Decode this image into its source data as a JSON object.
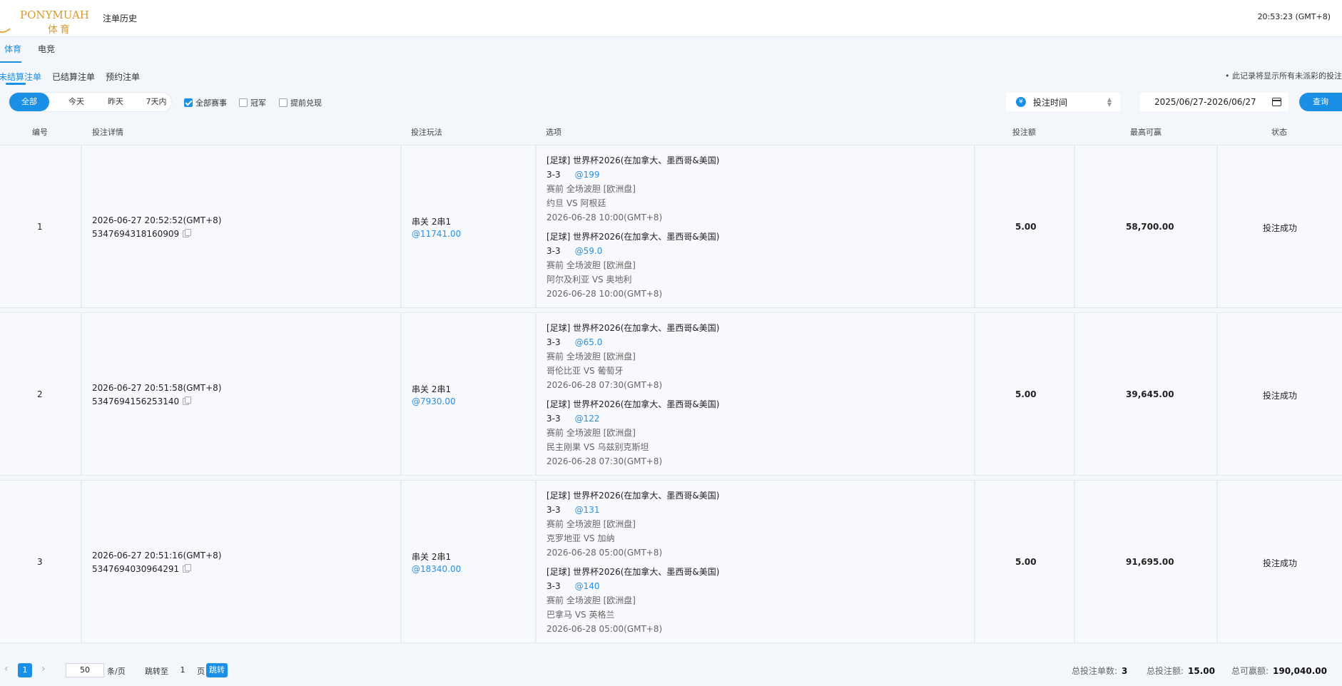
{
  "header": {
    "logo_text": "PONYMUAH",
    "logo_sub": "体育",
    "nav_label": "注单历史",
    "clock": "20:53:23 (GMT+8)"
  },
  "tabs": [
    "体育",
    "电竞"
  ],
  "subtabs": [
    "未结算注单",
    "已结算注单",
    "预约注单"
  ],
  "notice": "• 此记录将显示所有未派彩的投注",
  "filters": {
    "segments": [
      "全部",
      "今天",
      "昨天",
      "7天内"
    ],
    "checkboxes": [
      {
        "label": "全部赛事",
        "checked": true
      },
      {
        "label": "冠军",
        "checked": false
      },
      {
        "label": "提前兑现",
        "checked": false
      }
    ],
    "sort_icon": "¥",
    "sort_label": "投注时间",
    "date_range": "2025/06/27-2026/06/27",
    "query_label": "查询"
  },
  "columns": [
    "编号",
    "投注详情",
    "投注玩法",
    "选项",
    "投注额",
    "最高可赢",
    "状态"
  ],
  "rows": [
    {
      "no": "1",
      "time": "2026-06-27 20:52:52(GMT+8)",
      "bet_id": "5347694318160909",
      "play": "串关 2串1",
      "play_odds": "@11741.00",
      "selections": [
        {
          "league": "[足球] 世界杯2026(在加拿大、墨西哥&美国)",
          "pick": "3-3",
          "odds": "@199",
          "market": "赛前 全场波胆 [欧洲盘]",
          "match": "约旦 VS 阿根廷",
          "time": "2026-06-28 10:00(GMT+8)"
        },
        {
          "league": "[足球] 世界杯2026(在加拿大、墨西哥&美国)",
          "pick": "3-3",
          "odds": "@59.0",
          "market": "赛前 全场波胆 [欧洲盘]",
          "match": "阿尔及利亚 VS 奥地利",
          "time": "2026-06-28 10:00(GMT+8)"
        }
      ],
      "stake": "5.00",
      "max_win": "58,700.00",
      "status": "投注成功"
    },
    {
      "no": "2",
      "time": "2026-06-27 20:51:58(GMT+8)",
      "bet_id": "5347694156253140",
      "play": "串关 2串1",
      "play_odds": "@7930.00",
      "selections": [
        {
          "league": "[足球] 世界杯2026(在加拿大、墨西哥&美国)",
          "pick": "3-3",
          "odds": "@65.0",
          "market": "赛前 全场波胆 [欧洲盘]",
          "match": "哥伦比亚 VS 葡萄牙",
          "time": "2026-06-28 07:30(GMT+8)"
        },
        {
          "league": "[足球] 世界杯2026(在加拿大、墨西哥&美国)",
          "pick": "3-3",
          "odds": "@122",
          "market": "赛前 全场波胆 [欧洲盘]",
          "match": "民主刚果 VS 乌兹别克斯坦",
          "time": "2026-06-28 07:30(GMT+8)"
        }
      ],
      "stake": "5.00",
      "max_win": "39,645.00",
      "status": "投注成功"
    },
    {
      "no": "3",
      "time": "2026-06-27 20:51:16(GMT+8)",
      "bet_id": "5347694030964291",
      "play": "串关 2串1",
      "play_odds": "@18340.00",
      "selections": [
        {
          "league": "[足球] 世界杯2026(在加拿大、墨西哥&美国)",
          "pick": "3-3",
          "odds": "@131",
          "market": "赛前 全场波胆 [欧洲盘]",
          "match": "克罗地亚 VS 加纳",
          "time": "2026-06-28 05:00(GMT+8)"
        },
        {
          "league": "[足球] 世界杯2026(在加拿大、墨西哥&美国)",
          "pick": "3-3",
          "odds": "@140",
          "market": "赛前 全场波胆 [欧洲盘]",
          "match": "巴拿马 VS 英格兰",
          "time": "2026-06-28 05:00(GMT+8)"
        }
      ],
      "stake": "5.00",
      "max_win": "91,695.00",
      "status": "投注成功"
    }
  ],
  "footer": {
    "page": "1",
    "page_size": "50",
    "per_page_label": "条/页",
    "jump_label": "跳转至",
    "jump_value": "1",
    "page_label": "页",
    "jump_button": "跳转",
    "total_count_label": "总投注单数:",
    "total_count": "3",
    "total_stake_label": "总投注额:",
    "total_stake": "15.00",
    "total_win_label": "总可赢额:",
    "total_win": "190,040.00"
  }
}
